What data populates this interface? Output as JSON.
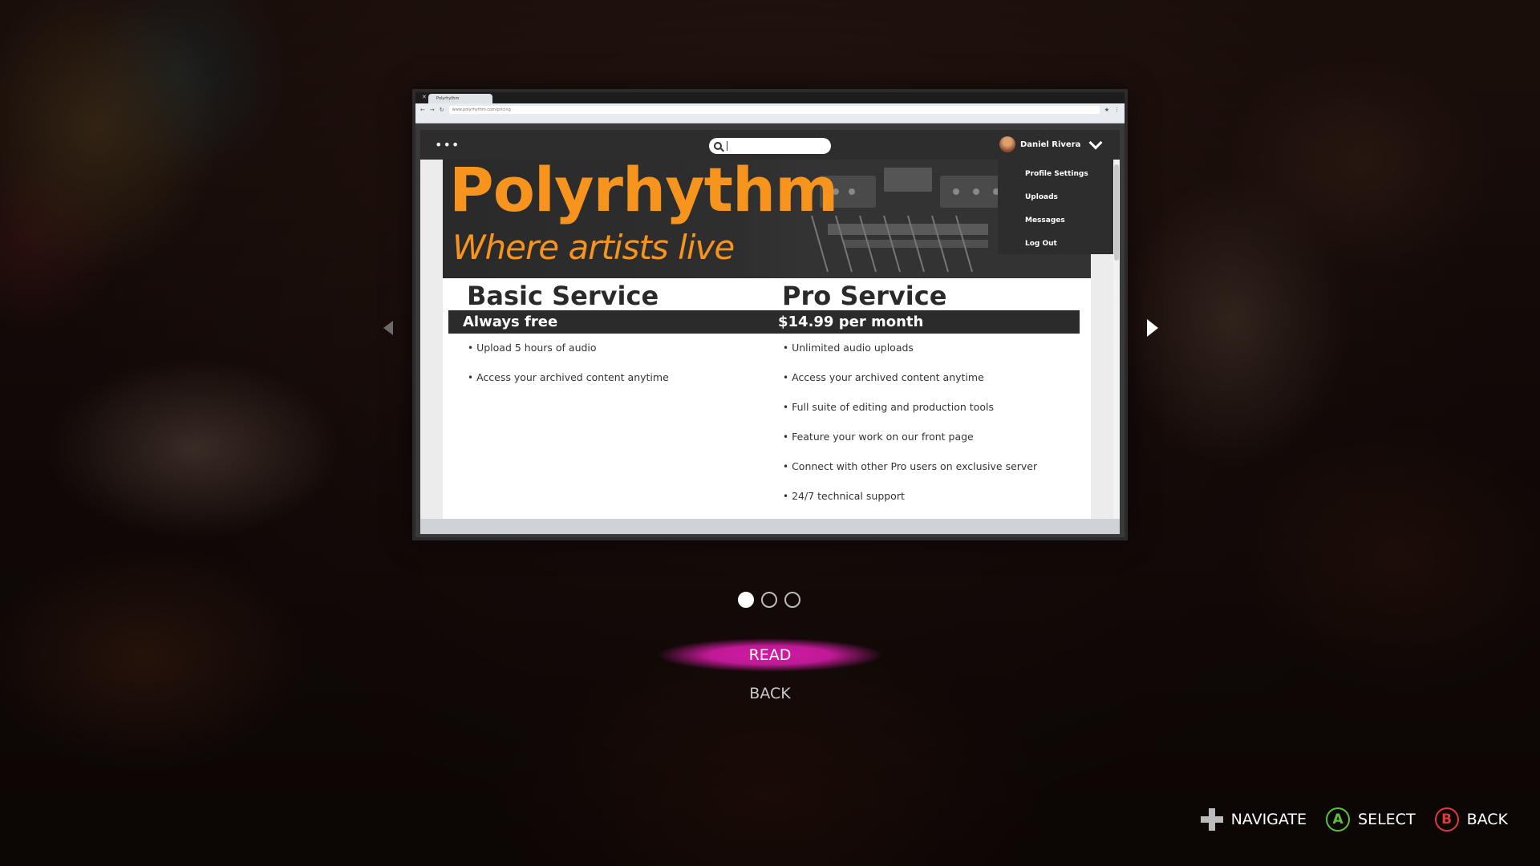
{
  "browser": {
    "tab_title": "Polyrhythm",
    "url": "www.polyrhythm.com/pricing"
  },
  "site": {
    "search_placeholder": "",
    "user_name": "Daniel Rivera",
    "dropdown_items": [
      "Profile Settings",
      "Uploads",
      "Messages",
      "Log Out"
    ],
    "hero_title": "Polyrhythm",
    "hero_tagline": "Where artists live",
    "brand_color": "#f7941d"
  },
  "plans": {
    "basic": {
      "name": "Basic Service",
      "price": "Always free",
      "features": [
        "Upload 5 hours of audio",
        "Access your archived content anytime"
      ]
    },
    "pro": {
      "name": "Pro Service",
      "price": "$14.99 per month",
      "features": [
        "Unlimited audio uploads",
        "Access your archived content anytime",
        "Full suite of editing and production tools",
        "Feature your work on our front page",
        "Connect with other Pro users on exclusive server",
        "24/7 technical support"
      ]
    }
  },
  "pager": {
    "total": 3,
    "active": 1
  },
  "menu": {
    "read": "READ",
    "back": "BACK",
    "highlight_color": "#c01996"
  },
  "hints": {
    "navigate": "NAVIGATE",
    "a_glyph": "A",
    "select": "SELECT",
    "b_glyph": "B",
    "back": "BACK"
  }
}
